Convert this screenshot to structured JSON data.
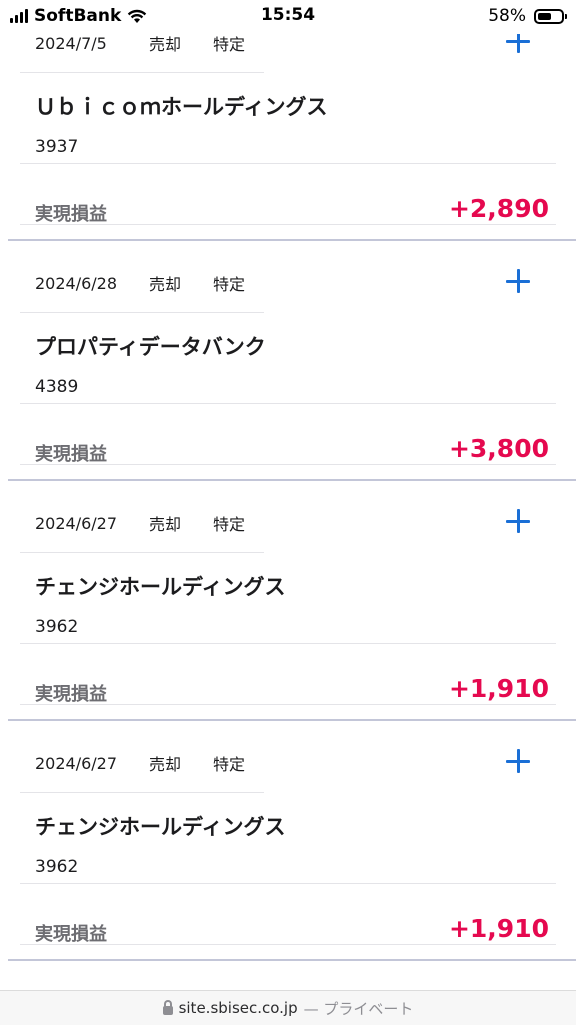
{
  "status_bar": {
    "carrier": "SoftBank",
    "time": "15:54",
    "battery_percent": "58%",
    "battery_level": 0.58
  },
  "trades": [
    {
      "date": "2024/7/5",
      "side": "売却",
      "account": "特定",
      "name": "Ｕｂｉｃｏｍホールディングス",
      "code": "3937",
      "pnl_label": "実現損益",
      "pnl_value": "+2,890"
    },
    {
      "date": "2024/6/28",
      "side": "売却",
      "account": "特定",
      "name": "プロパティデータバンク",
      "code": "4389",
      "pnl_label": "実現損益",
      "pnl_value": "+3,800"
    },
    {
      "date": "2024/6/27",
      "side": "売却",
      "account": "特定",
      "name": "チェンジホールディングス",
      "code": "3962",
      "pnl_label": "実現損益",
      "pnl_value": "+1,910"
    },
    {
      "date": "2024/6/27",
      "side": "売却",
      "account": "特定",
      "name": "チェンジホールディングス",
      "code": "3962",
      "pnl_label": "実現損益",
      "pnl_value": "+1,910"
    }
  ],
  "icons": {
    "expand": "plus-icon",
    "lock": "lock-icon"
  },
  "colors": {
    "accent": "#1a6fd6",
    "profit": "#e5094f",
    "separator": "#c3c6d8"
  },
  "url_bar": {
    "domain": "site.sbisec.co.jp",
    "mode": "— プライベート"
  }
}
